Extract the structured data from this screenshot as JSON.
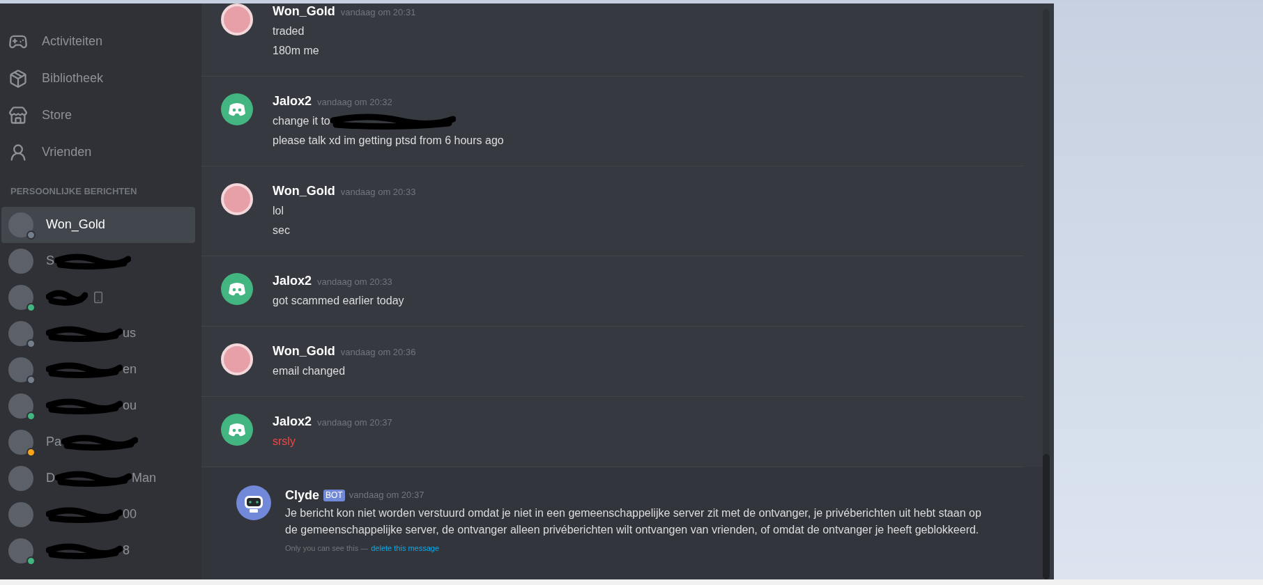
{
  "nav": [
    {
      "label": "Activiteiten",
      "kind": "activity"
    },
    {
      "label": "Bibliotheek",
      "kind": "library"
    },
    {
      "label": "Store",
      "kind": "store"
    },
    {
      "label": "Vrienden",
      "kind": "friends"
    }
  ],
  "dm_header": "PERSOONLIJKE BERICHTEN",
  "dms": [
    {
      "name": "Won_Gold",
      "redacted": false,
      "selected": true,
      "color": "#747f8d"
    },
    {
      "redacted": true,
      "selected": false,
      "prefix": "S"
    },
    {
      "redacted": true,
      "selected": false,
      "mobile": true,
      "color": "#43b581"
    },
    {
      "redacted": true,
      "selected": false,
      "suffix": "us",
      "color": "#747f8d"
    },
    {
      "redacted": true,
      "selected": false,
      "suffix": "en",
      "color": "#747f8d"
    },
    {
      "redacted": true,
      "selected": false,
      "suffix": "ou",
      "color": "#43b581"
    },
    {
      "redacted": true,
      "selected": false,
      "prefix": "Pa",
      "color": "#faa61a"
    },
    {
      "redacted": true,
      "selected": false,
      "prefix": "D",
      "suffix": "Man"
    },
    {
      "redacted": true,
      "selected": false,
      "suffix": "00"
    },
    {
      "redacted": true,
      "selected": false,
      "suffix": "8",
      "color": "#43b581"
    }
  ],
  "messages": [
    {
      "author": "Won_Gold",
      "kind": "flower",
      "time": "vandaag om 20:31",
      "lines": [
        {
          "text": "traded",
          "failed": false
        },
        {
          "text": "180m me",
          "failed": false
        }
      ]
    },
    {
      "author": "Jalox2",
      "kind": "default",
      "time": "vandaag om 20:32",
      "lines": [
        {
          "text": "change it to",
          "failed": false,
          "redacted_tail": true
        },
        {
          "text": "please talk xd im getting ptsd from 6 hours ago",
          "failed": false
        }
      ]
    },
    {
      "author": "Won_Gold",
      "kind": "flower",
      "time": "vandaag om 20:33",
      "lines": [
        {
          "text": "lol",
          "failed": false
        },
        {
          "text": "sec",
          "failed": false
        }
      ]
    },
    {
      "author": "Jalox2",
      "kind": "default",
      "time": "vandaag om 20:33",
      "lines": [
        {
          "text": "got scammed earlier today",
          "failed": false
        }
      ]
    },
    {
      "author": "Won_Gold",
      "kind": "flower",
      "time": "vandaag om 20:36",
      "lines": [
        {
          "text": "email changed",
          "failed": false
        }
      ]
    },
    {
      "author": "Jalox2",
      "kind": "default",
      "time": "vandaag om 20:37",
      "lines": [
        {
          "text": "srsly",
          "failed": true
        }
      ]
    }
  ],
  "system_message": {
    "author": "Clyde",
    "badge": "BOT",
    "time": "vandaag om 20:37",
    "text": "Je bericht kon niet worden verstuurd omdat je niet in een gemeenschappelijke server zit met de ontvanger, je privéberichten uit hebt staan op de gemeenschappelijke server, de ontvanger alleen privéberichten wilt ontvangen van vrienden, of omdat de ontvanger je heeft geblokkeerd.",
    "note": "Only you can see this —",
    "link": "delete this message"
  }
}
